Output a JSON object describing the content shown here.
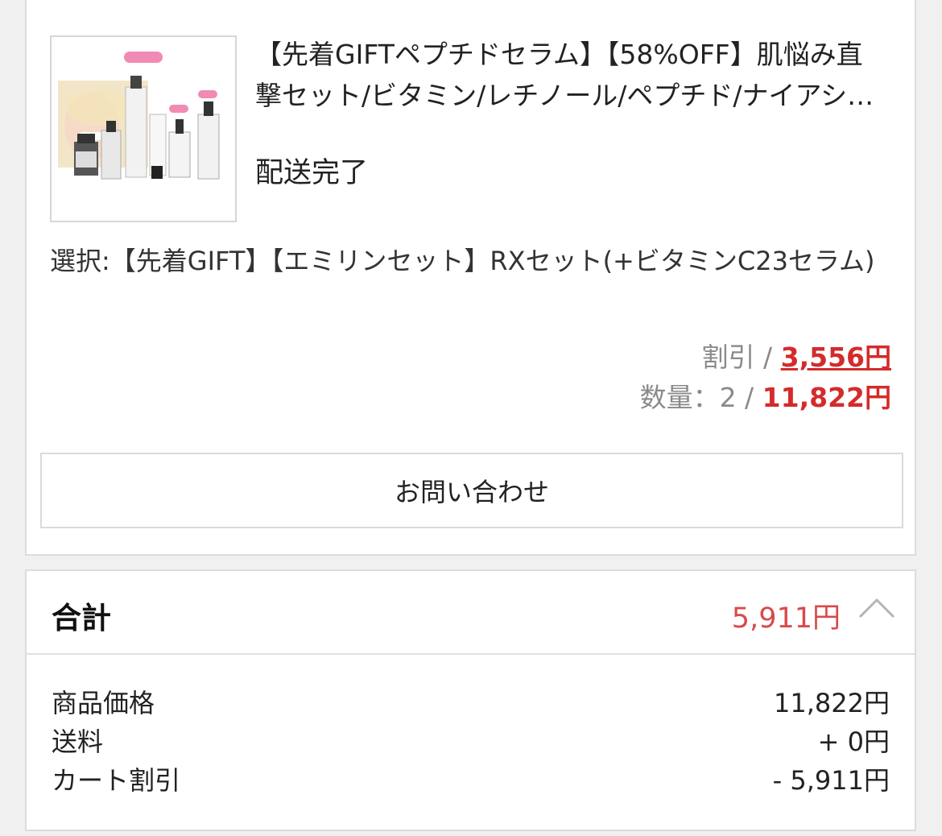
{
  "order_item": {
    "product_name": "【先着GIFTペプチドセラム】【58%OFF】肌悩み直撃セット/ビタミン/レチノール/ペプチド/ナイアシンアミド",
    "delivery_status": "配送完了",
    "option": "選択:【先着GIFT】【エミリンセット】RXセット(+ビタミンC23セラム)",
    "discount_label": "割引 / ",
    "discount_value": "3,556円",
    "quantity_label": "数量：2 / ",
    "quantity_value": "11,822円",
    "inquiry_button": "お問い合わせ"
  },
  "total": {
    "title": "合計",
    "amount": "5,911円",
    "rows": [
      {
        "label": "商品価格",
        "value": "11,822円"
      },
      {
        "label": "送料",
        "value": "+ 0円"
      },
      {
        "label": "カート割引",
        "value": "- 5,911円"
      }
    ]
  },
  "colors": {
    "accent_red": "#d42b2b",
    "total_red": "#d94a4a",
    "border": "#dcdcdc",
    "background": "#f0f0f0"
  },
  "icons": {
    "collapse": "chevron-up-icon",
    "product": "product-thumbnail"
  }
}
